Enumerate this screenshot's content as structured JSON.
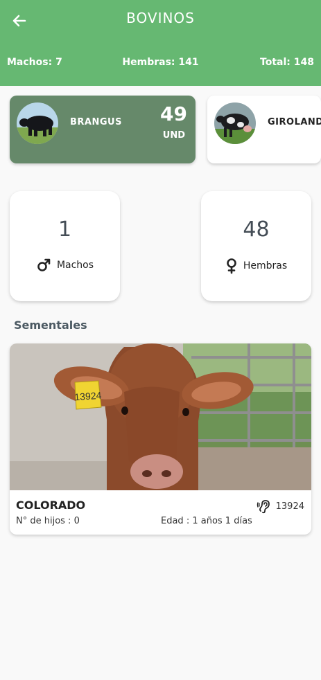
{
  "header": {
    "title": "BOVINOS",
    "machos": "Machos: 7",
    "hembras": "Hembras: 141",
    "total": "Total: 148"
  },
  "breeds": [
    {
      "name": "BRANGUS",
      "count": "49",
      "unit": "UND",
      "selected": true
    },
    {
      "name": "GIROLANDO",
      "selected": false
    }
  ],
  "sex_summary": {
    "males": {
      "count": "1",
      "label": "Machos"
    },
    "females": {
      "count": "48",
      "label": "Hembras"
    }
  },
  "section_title": "Sementales",
  "animal": {
    "name": "COLORADO",
    "tag": "13924",
    "tag_on_ear": "13924",
    "sons": "N° de hijos : 0",
    "age": "Edad : 1 años  1 días"
  },
  "colors": {
    "header": "#66b872",
    "selected_card": "#66896a"
  },
  "icons": {
    "back": "arrow-left-icon",
    "male": "male-icon",
    "female": "female-icon",
    "tag": "ear-tag-icon"
  }
}
